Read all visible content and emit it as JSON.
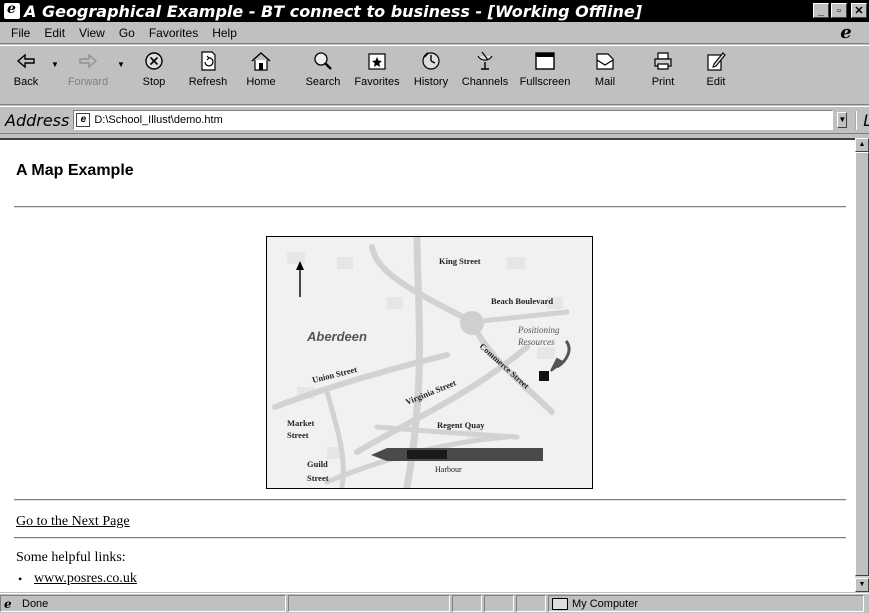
{
  "window": {
    "title": "A Geographical Example - BT connect to business - [Working Offline]",
    "minimize_glyph": "_",
    "maximize_glyph": "▫",
    "close_glyph": "✕"
  },
  "menu": {
    "items": [
      "File",
      "Edit",
      "View",
      "Go",
      "Favorites",
      "Help"
    ]
  },
  "toolbar": {
    "buttons": [
      {
        "label": "Back",
        "icon": "back-arrow-icon"
      },
      {
        "label": "Forward",
        "icon": "forward-arrow-icon",
        "disabled": true
      },
      {
        "label": "Stop",
        "icon": "stop-icon"
      },
      {
        "label": "Refresh",
        "icon": "refresh-icon"
      },
      {
        "label": "Home",
        "icon": "home-icon"
      },
      {
        "label": "Search",
        "icon": "search-icon"
      },
      {
        "label": "Favorites",
        "icon": "favorites-icon"
      },
      {
        "label": "History",
        "icon": "history-icon"
      },
      {
        "label": "Channels",
        "icon": "channels-icon"
      },
      {
        "label": "Fullscreen",
        "icon": "fullscreen-icon"
      },
      {
        "label": "Mail",
        "icon": "mail-icon"
      },
      {
        "label": "Print",
        "icon": "print-icon"
      },
      {
        "label": "Edit",
        "icon": "edit-icon"
      }
    ]
  },
  "address": {
    "label": "Address",
    "value": "D:\\School_Illust\\demo.htm",
    "links_label": "Links"
  },
  "page": {
    "title": "A Map Example",
    "map": {
      "labels": {
        "king_street": "King Street",
        "beach_boulevard": "Beach Boulevard",
        "positioning_resources_1": "Positioning",
        "positioning_resources_2": "Resources",
        "aberdeen": "Aberdeen",
        "commerce_street": "Commerce Street",
        "union_street": "Union Street",
        "virginia_street": "Virginia Street",
        "market_street_1": "Market",
        "market_street_2": "Street",
        "regent_quay": "Regent Quay",
        "guild_street_1": "Guild",
        "guild_street_2": "Street",
        "harbour": "Harbour"
      }
    },
    "next_link": "Go to the Next Page",
    "helpful_heading": "Some helpful links:",
    "helpful_link": "www.posres.co.uk"
  },
  "status": {
    "text": "Done",
    "zone": "My Computer"
  }
}
